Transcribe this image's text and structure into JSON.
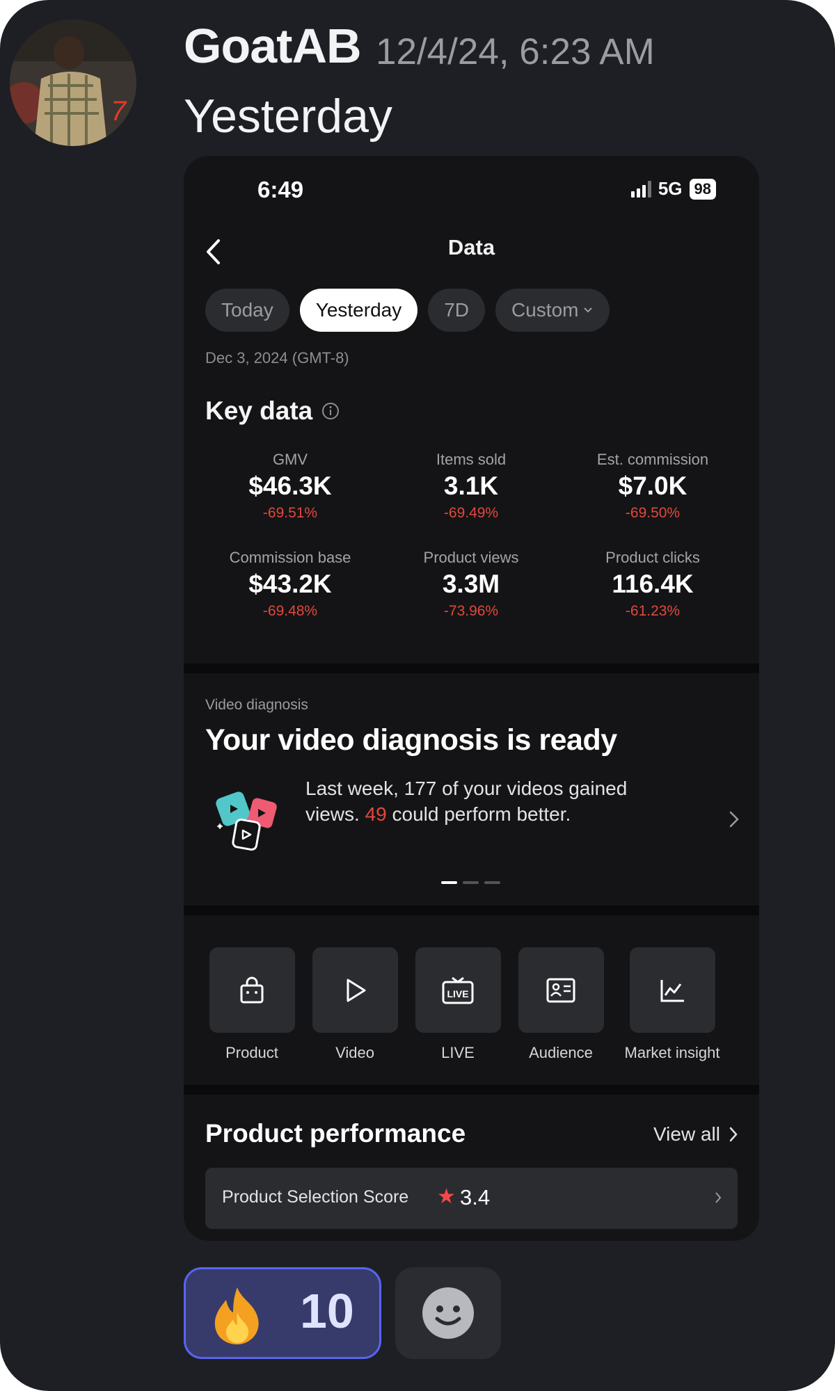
{
  "message": {
    "username": "GoatAB",
    "timestamp": "12/4/24, 6:23 AM",
    "text": "Yesterday"
  },
  "phone": {
    "status": {
      "time": "6:49",
      "network": "5G",
      "battery": "98"
    },
    "nav": {
      "title": "Data"
    },
    "tabs": [
      {
        "label": "Today",
        "active": false
      },
      {
        "label": "Yesterday",
        "active": true
      },
      {
        "label": "7D",
        "active": false
      },
      {
        "label": "Custom",
        "active": false
      }
    ],
    "date_range": "Dec 3, 2024 (GMT-8)",
    "key_data": {
      "title": "Key data",
      "metrics": [
        {
          "label": "GMV",
          "value": "$46.3K",
          "change": "-69.51%"
        },
        {
          "label": "Items sold",
          "value": "3.1K",
          "change": "-69.49%"
        },
        {
          "label": "Est. commission",
          "value": "$7.0K",
          "change": "-69.50%"
        },
        {
          "label": "Commission base",
          "value": "$43.2K",
          "change": "-69.48%"
        },
        {
          "label": "Product views",
          "value": "3.3M",
          "change": "-73.96%"
        },
        {
          "label": "Product clicks",
          "value": "116.4K",
          "change": "-61.23%"
        }
      ]
    },
    "video_diagnosis": {
      "kicker": "Video diagnosis",
      "title": "Your video diagnosis is ready",
      "body_part1": "Last week, 177 of your videos gained views.",
      "body_highlight": "49",
      "body_part2": "could perform better.",
      "page_dots": 3,
      "active_dot": 0
    },
    "shortcuts": [
      {
        "label": "Product",
        "icon": "shopping-bag-icon"
      },
      {
        "label": "Video",
        "icon": "play-icon"
      },
      {
        "label": "LIVE",
        "icon": "live-tv-icon"
      },
      {
        "label": "Audience",
        "icon": "contact-card-icon"
      },
      {
        "label": "Market insight",
        "icon": "line-chart-icon"
      }
    ],
    "product_performance": {
      "title": "Product performance",
      "view_all": "View all",
      "score_label": "Product Selection Score",
      "score_value": "3.4"
    }
  },
  "reactions": [
    {
      "emoji": "fire-icon",
      "count": "10",
      "selected": true
    }
  ],
  "colors": {
    "background": "#1e1f24",
    "phone_background": "#141416",
    "negative": "#e2483c",
    "reaction_border": "#5865f2",
    "reaction_fill": "#373b6b"
  }
}
